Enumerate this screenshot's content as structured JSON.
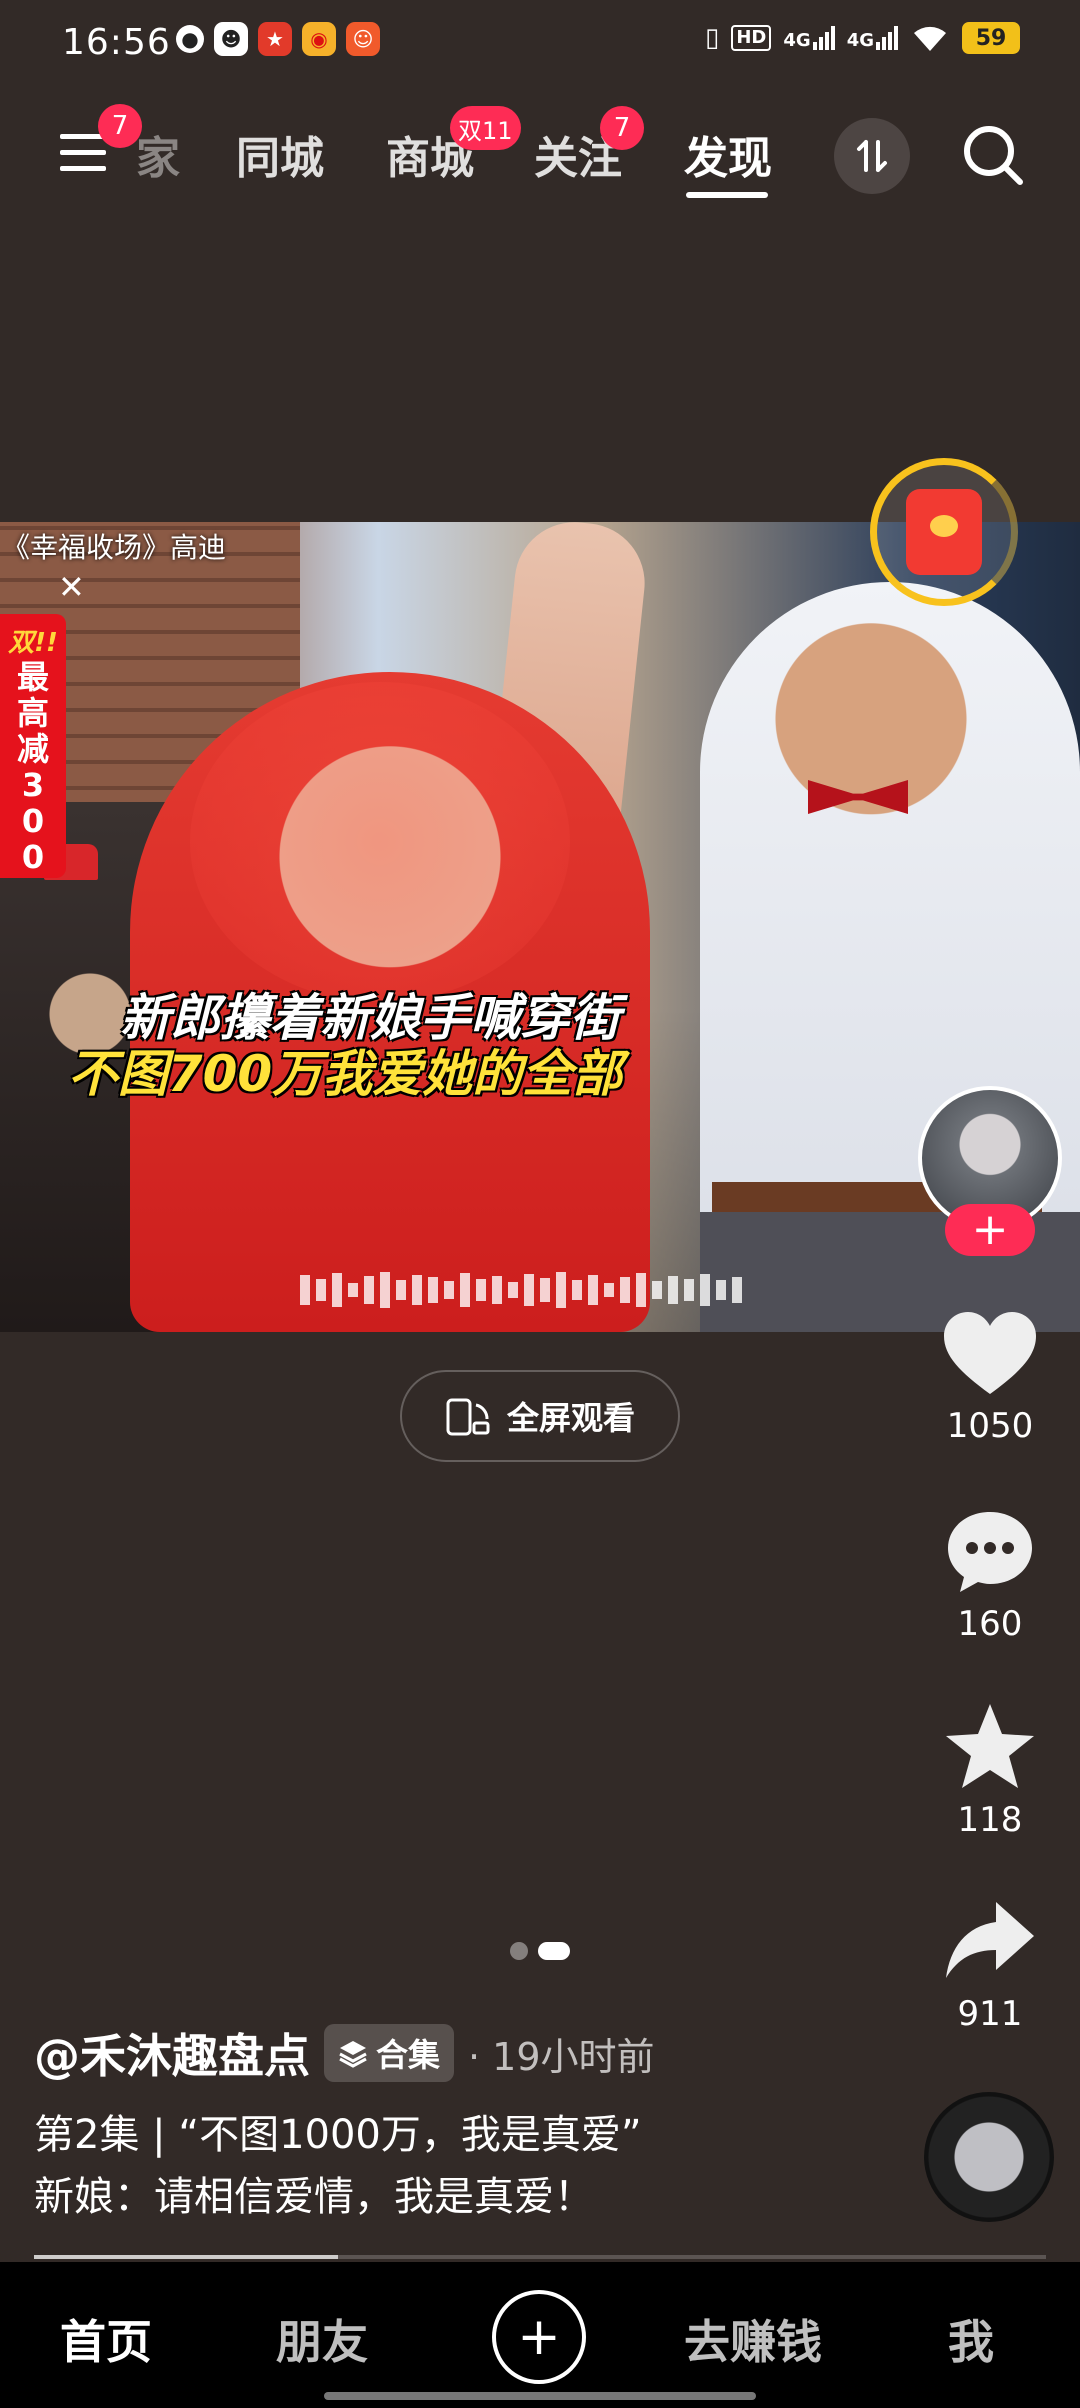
{
  "status_bar": {
    "time": "16:56",
    "net1": "4G",
    "net2": "4G",
    "hd": "HD",
    "battery": "59"
  },
  "top_nav": {
    "menu_badge": "7",
    "tab_partial": "家",
    "tabs": [
      "同城",
      "商城",
      "关注",
      "发现"
    ],
    "mall_badge": "双11",
    "follow_badge": "7",
    "active_tab": "发现"
  },
  "video": {
    "source": "《幸福收场》高迪",
    "promo_top": "双!!",
    "promo_text": "最高减300",
    "caption_line1": "新郎攥着新娘手喊穿街",
    "caption_line2": "不图700万我爱她的全部"
  },
  "fullscreen_label": "全屏观看",
  "actions": {
    "likes": "1050",
    "comments": "160",
    "favorites": "118",
    "shares": "911"
  },
  "follow_plus": "+",
  "info": {
    "author": "@禾沐趣盘点",
    "collection_label": "合集",
    "posted": "· 19小时前",
    "desc_line1": "第2集 | “不图1000万，我是真爱”",
    "desc_line2": "新娘：请相信爱情，我是真爱！"
  },
  "progress": 0.3,
  "bottom_nav": {
    "home": "首页",
    "friends": "朋友",
    "plus": "+",
    "earn": "去赚钱",
    "me": "我"
  },
  "colors": {
    "background": "#322a27",
    "accent": "#fe2c55",
    "caption_yellow": "#ffe23a"
  }
}
